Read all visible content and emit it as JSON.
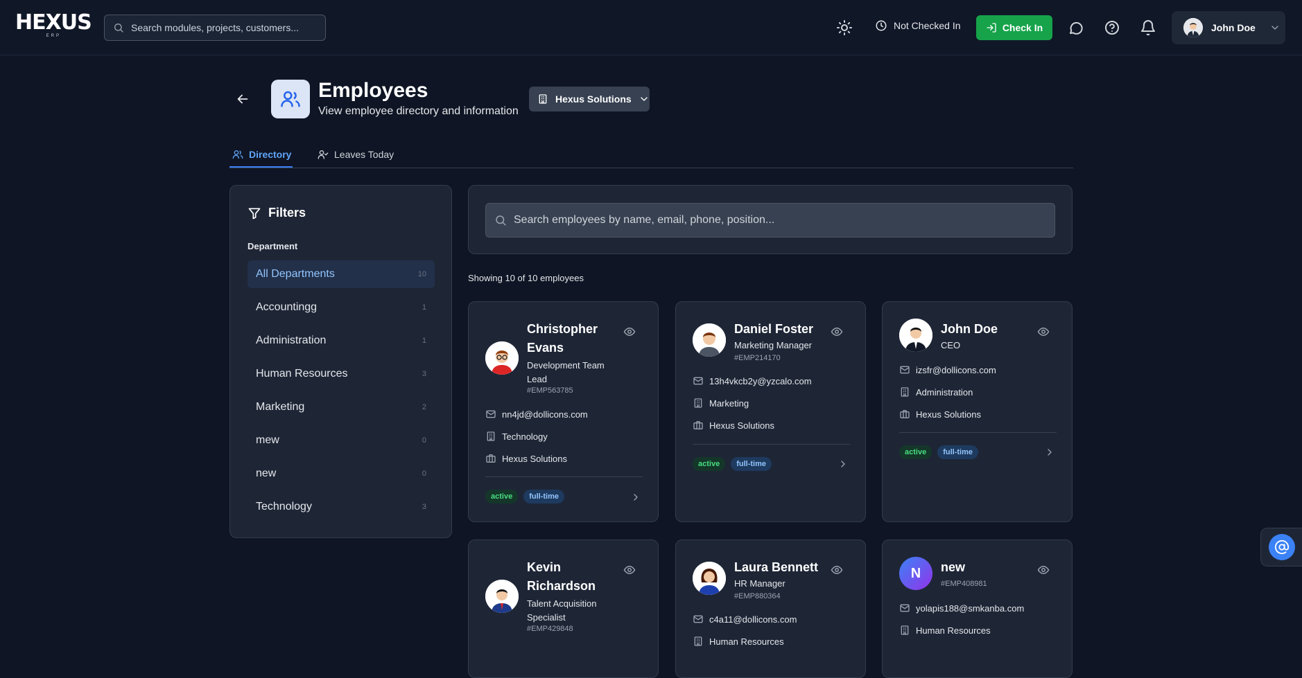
{
  "app": {
    "logo": "HEXUS",
    "logo_sub": "ERP"
  },
  "header": {
    "search_placeholder": "Search modules, projects, customers...",
    "status_text": "Not Checked In",
    "checkin_label": "Check In",
    "user_name": "John Doe"
  },
  "page": {
    "title": "Employees",
    "subtitle": "View employee directory and information",
    "company": "Hexus Solutions"
  },
  "tabs": [
    {
      "label": "Directory"
    },
    {
      "label": "Leaves Today"
    }
  ],
  "filters": {
    "title": "Filters",
    "section": "Department",
    "items": [
      {
        "label": "All Departments",
        "count": "10"
      },
      {
        "label": "Accountingg",
        "count": "1"
      },
      {
        "label": "Administration",
        "count": "1"
      },
      {
        "label": "Human Resources",
        "count": "3"
      },
      {
        "label": "Marketing",
        "count": "2"
      },
      {
        "label": "mew",
        "count": "0"
      },
      {
        "label": "new",
        "count": "0"
      },
      {
        "label": "Technology",
        "count": "3"
      }
    ]
  },
  "directory": {
    "search_placeholder": "Search employees by name, email, phone, position...",
    "showing": "Showing 10 of 10 employees"
  },
  "employees": [
    {
      "name": "Christopher Evans",
      "role": "Development Team Lead",
      "id": "#EMP563785",
      "email": "nn4jd@dollicons.com",
      "department": "Technology",
      "company": "Hexus Solutions",
      "status": "active",
      "type": "full-time"
    },
    {
      "name": "Daniel Foster",
      "role": "Marketing Manager",
      "id": "#EMP214170",
      "email": "13h4vkcb2y@yzcalo.com",
      "department": "Marketing",
      "company": "Hexus Solutions",
      "status": "active",
      "type": "full-time"
    },
    {
      "name": "John Doe",
      "role": "CEO",
      "email": "izsfr@dollicons.com",
      "department": "Administration",
      "company": "Hexus Solutions",
      "status": "active",
      "type": "full-time"
    },
    {
      "name": "Kevin Richardson",
      "role": "Talent Acquisition Specialist",
      "id": "#EMP429848"
    },
    {
      "name": "Laura Bennett",
      "role": "HR Manager",
      "id": "#EMP880364",
      "email": "c4a11@dollicons.com",
      "department": "Human Resources"
    },
    {
      "name": "new",
      "initial": "N",
      "id": "#EMP408981",
      "email": "yolapis188@smkanba.com",
      "department": "Human Resources"
    }
  ]
}
